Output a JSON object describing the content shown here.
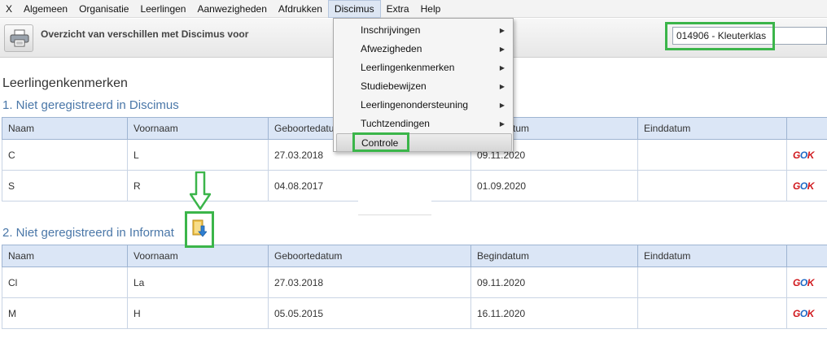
{
  "menubar": {
    "items": [
      "X",
      "Algemeen",
      "Organisatie",
      "Leerlingen",
      "Aanwezigheden",
      "Afdrukken",
      "Discimus",
      "Extra",
      "Help"
    ]
  },
  "toolbar": {
    "title": "Overzicht van verschillen met Discimus voor",
    "class_select": "014906 - Kleuterklas"
  },
  "page": {
    "heading": "Leerlingenkenmerken"
  },
  "section1": {
    "title": "1. Niet geregistreerd in Discimus",
    "columns": [
      "Naam",
      "Voornaam",
      "Geboortedatum",
      "Begindatum",
      "Einddatum",
      ""
    ],
    "rows": [
      {
        "naam": "C",
        "voornaam": "L",
        "geboortedatum": "27.03.2018",
        "begindatum": "09.11.2020",
        "einddatum": "",
        "logo": "GOK"
      },
      {
        "naam": "S",
        "voornaam": "R",
        "geboortedatum": "04.08.2017",
        "begindatum": "01.09.2020",
        "einddatum": "",
        "logo": "GOK"
      }
    ]
  },
  "section2": {
    "title": "2. Niet geregistreerd in Informat",
    "columns": [
      "Naam",
      "Voornaam",
      "Geboortedatum",
      "Begindatum",
      "Einddatum",
      ""
    ],
    "rows": [
      {
        "naam": "Cl",
        "voornaam": "La",
        "geboortedatum": "27.03.2018",
        "begindatum": "09.11.2020",
        "einddatum": "",
        "logo": "GOK"
      },
      {
        "naam": "M",
        "voornaam": "H",
        "geboortedatum": "05.05.2015",
        "begindatum": "16.11.2020",
        "einddatum": "",
        "logo": "GOK"
      }
    ]
  },
  "dropdown": {
    "items": [
      {
        "label": "Inschrijvingen",
        "submenu": true
      },
      {
        "label": "Afwezigheden",
        "submenu": true
      },
      {
        "label": "Leerlingenkenmerken",
        "submenu": true
      },
      {
        "label": "Studiebewijzen",
        "submenu": true
      },
      {
        "label": "Leerlingenondersteuning",
        "submenu": true
      },
      {
        "label": "Tuchtzendingen",
        "submenu": true
      },
      {
        "label": "Controle",
        "submenu": false
      }
    ]
  },
  "colors": {
    "highlight": "#3bb54a",
    "header_bg": "#dbe6f6",
    "section_title": "#4a77a8",
    "gok_red": "#d0181d",
    "gok_blue": "#1e69c6"
  },
  "icons": {
    "printer": "printer-icon",
    "submenu_arrow": "chevron-right-icon",
    "annotation_arrow": "down-arrow-icon",
    "import": "import-folder-icon"
  }
}
